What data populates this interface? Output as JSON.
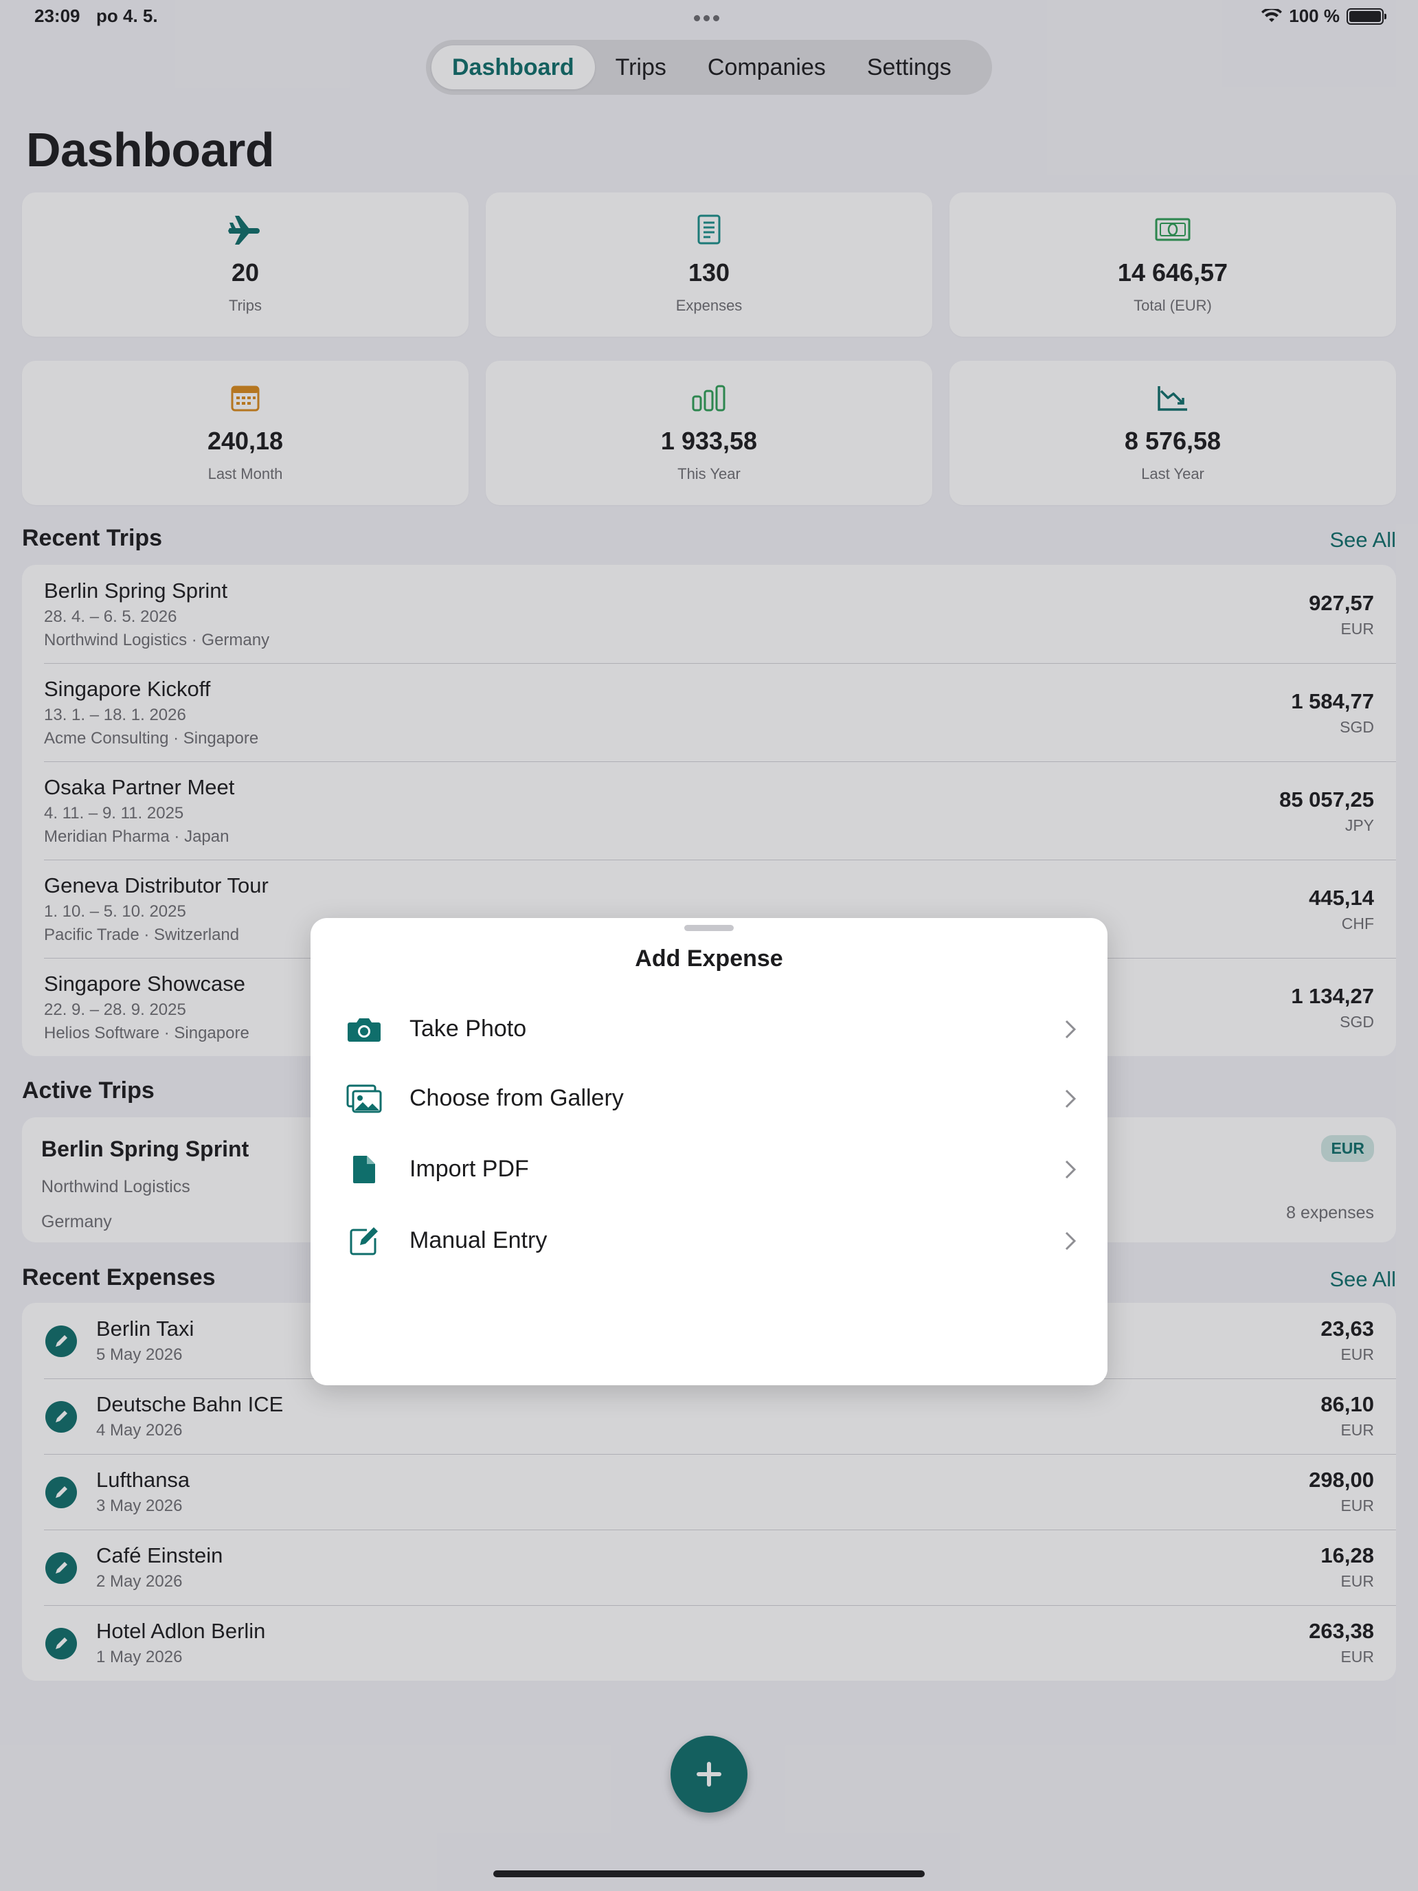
{
  "status_bar": {
    "time": "23:09",
    "date": "po 4. 5.",
    "battery": "100 %"
  },
  "tabs": [
    {
      "label": "Dashboard",
      "active": true
    },
    {
      "label": "Trips",
      "active": false
    },
    {
      "label": "Companies",
      "active": false
    },
    {
      "label": "Settings",
      "active": false
    }
  ],
  "title": "Dashboard",
  "stats": [
    {
      "value": "20",
      "label": "Trips",
      "icon": "airplane-icon",
      "color": "#0f6e6b"
    },
    {
      "value": "130",
      "label": "Expenses",
      "icon": "receipt-icon",
      "color": "#1b8f8a"
    },
    {
      "value": "14 646,57",
      "label": "Total (EUR)",
      "icon": "banknote-icon",
      "color": "#2f9e57"
    },
    {
      "value": "240,18",
      "label": "Last Month",
      "icon": "calendar-icon",
      "color": "#d98a1c"
    },
    {
      "value": "1 933,58",
      "label": "This Year",
      "icon": "bar-chart-icon",
      "color": "#2f9e57"
    },
    {
      "value": "8 576,58",
      "label": "Last Year",
      "icon": "trend-down-icon",
      "color": "#0f6e6b"
    }
  ],
  "recent_trips": {
    "title": "Recent Trips",
    "see_all": "See All",
    "items": [
      {
        "name": "Berlin Spring Sprint",
        "dates": "28. 4. – 6. 5. 2026",
        "meta": "Northwind Logistics · Germany",
        "amount": "927,57",
        "currency": "EUR"
      },
      {
        "name": "Singapore Kickoff",
        "dates": "13. 1. – 18. 1. 2026",
        "meta": "Acme Consulting · Singapore",
        "amount": "1 584,77",
        "currency": "SGD"
      },
      {
        "name": "Osaka Partner Meet",
        "dates": "4. 11. – 9. 11. 2025",
        "meta": "Meridian Pharma · Japan",
        "amount": "85 057,25",
        "currency": "JPY"
      },
      {
        "name": "Geneva Distributor Tour",
        "dates": "1. 10. – 5. 10. 2025",
        "meta": "Pacific Trade · Switzerland",
        "amount": "445,14",
        "currency": "CHF"
      },
      {
        "name": "Singapore Showcase",
        "dates": "22. 9. – 28. 9. 2025",
        "meta": "Helios Software · Singapore",
        "amount": "1 134,27",
        "currency": "SGD"
      }
    ]
  },
  "active_trips": {
    "title": "Active Trips",
    "item": {
      "name": "Berlin Spring Sprint",
      "company": "Northwind Logistics",
      "country": "Germany",
      "badge": "EUR",
      "count": "8 expenses"
    }
  },
  "recent_expenses": {
    "title": "Recent Expenses",
    "see_all": "See All",
    "items": [
      {
        "name": "Berlin Taxi",
        "date": "5 May 2026",
        "amount": "23,63",
        "currency": "EUR"
      },
      {
        "name": "Deutsche Bahn ICE",
        "date": "4 May 2026",
        "amount": "86,10",
        "currency": "EUR"
      },
      {
        "name": "Lufthansa",
        "date": "3 May 2026",
        "amount": "298,00",
        "currency": "EUR"
      },
      {
        "name": "Café Einstein",
        "date": "2 May 2026",
        "amount": "16,28",
        "currency": "EUR"
      },
      {
        "name": "Hotel Adlon Berlin",
        "date": "1 May 2026",
        "amount": "263,38",
        "currency": "EUR"
      }
    ]
  },
  "sheet": {
    "title": "Add Expense",
    "options": [
      {
        "label": "Take Photo",
        "icon": "camera-icon"
      },
      {
        "label": "Choose from Gallery",
        "icon": "photo-gallery-icon"
      },
      {
        "label": "Import PDF",
        "icon": "document-icon"
      },
      {
        "label": "Manual Entry",
        "icon": "compose-icon"
      }
    ]
  },
  "colors": {
    "accent": "#0f6e6b",
    "background": "#f2f2f7",
    "card": "#ffffff"
  }
}
